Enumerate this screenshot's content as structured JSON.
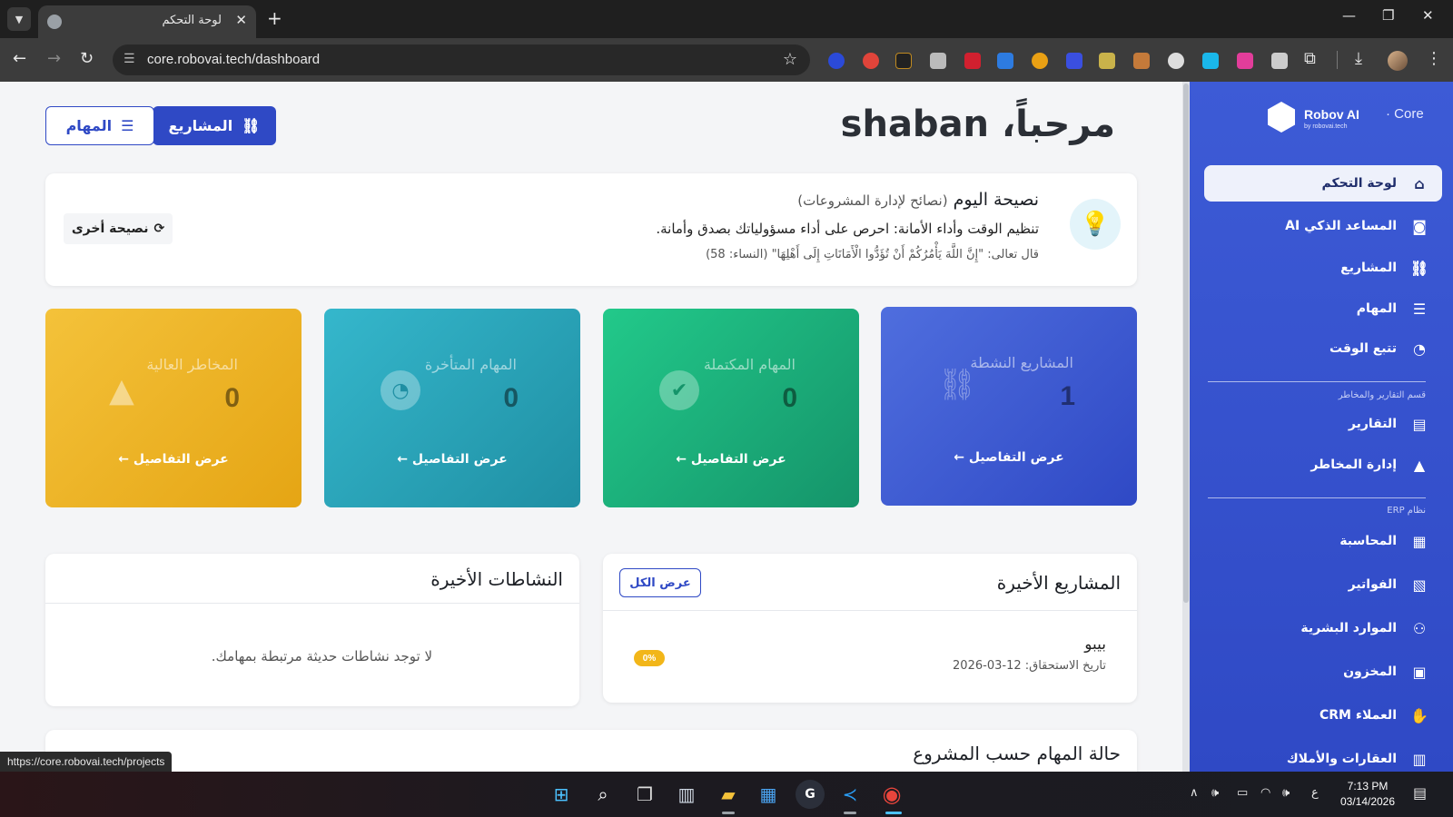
{
  "browser": {
    "tab_title": "لوحة التحكم",
    "url": "core.robovai.tech/dashboard",
    "status_url": "https://core.robovai.tech/projects"
  },
  "sidebar": {
    "brand_name": "Robov AI",
    "brand_product": "· Core",
    "brand_sub": "by robovai.tech",
    "items": [
      {
        "label": "لوحة التحكم",
        "icon": "home-icon"
      },
      {
        "label": "المساعد الذكي AI",
        "icon": "robot-icon"
      },
      {
        "label": "المشاريع",
        "icon": "project-diagram-icon"
      },
      {
        "label": "المهام",
        "icon": "tasks-icon"
      },
      {
        "label": "تتبع الوقت",
        "icon": "clock-icon"
      },
      {
        "label": "التقارير",
        "icon": "chart-icon"
      },
      {
        "label": "إدارة المخاطر",
        "icon": "warning-icon"
      },
      {
        "label": "المحاسبة",
        "icon": "calculator-icon"
      },
      {
        "label": "الفواتير",
        "icon": "invoice-icon"
      },
      {
        "label": "الموارد البشرية",
        "icon": "users-icon"
      },
      {
        "label": "المخزون",
        "icon": "boxes-icon"
      },
      {
        "label": "العملاء CRM",
        "icon": "handshake-icon"
      },
      {
        "label": "العقارات والأملاك",
        "icon": "building-icon"
      }
    ],
    "section_reports": "قسم التقارير والمخاطر",
    "section_erp": "نظام ERP"
  },
  "header": {
    "welcome": "مرحباً، shaban",
    "projects_button": "المشاريع",
    "tasks_button": "المهام"
  },
  "tip": {
    "title": "نصيحة اليوم",
    "category": "(نصائح لإدارة المشروعات)",
    "text": "تنظيم الوقت وأداء الأمانة: احرص على أداء مسؤولياتك بصدق وأمانة.",
    "verse": "قال تعالى: \"إِنَّ اللَّهَ يَأْمُرُكُمْ أَنْ تُؤَدُّوا الْأَمَانَاتِ إِلَى أَهْلِهَا\" (النساء: 58)",
    "another_button": "نصيحة أخرى"
  },
  "stats": [
    {
      "label": "المشاريع النشطة",
      "value": "1",
      "link": "عرض التفاصيل",
      "color": "#2f49c5",
      "icon": "project-diagram-icon"
    },
    {
      "label": "المهام المكتملة",
      "value": "0",
      "link": "عرض التفاصيل",
      "color": "#15946a",
      "icon": "check-circle-icon"
    },
    {
      "label": "المهام المتأخرة",
      "value": "0",
      "link": "عرض التفاصيل",
      "color": "#1f8fa3",
      "icon": "clock-icon"
    },
    {
      "label": "المخاطر العالية",
      "value": "0",
      "link": "عرض التفاصيل",
      "color": "#e5a514",
      "icon": "warning-icon"
    }
  ],
  "recent_projects": {
    "title": "المشاريع الأخيرة",
    "view_all": "عرض الكل",
    "items": [
      {
        "name": "بيبو",
        "due": "تاريخ الاستحقاق: 12-03-2026",
        "progress": "0%"
      }
    ]
  },
  "recent_activities": {
    "title": "النشاطات الأخيرة",
    "empty": "لا توجد نشاطات حديثة مرتبطة بمهامك."
  },
  "task_status": {
    "title": "حالة المهام حسب المشروع"
  },
  "taskbar": {
    "time": "7:13 PM",
    "date": "03/14/2026",
    "lang": "ع"
  }
}
